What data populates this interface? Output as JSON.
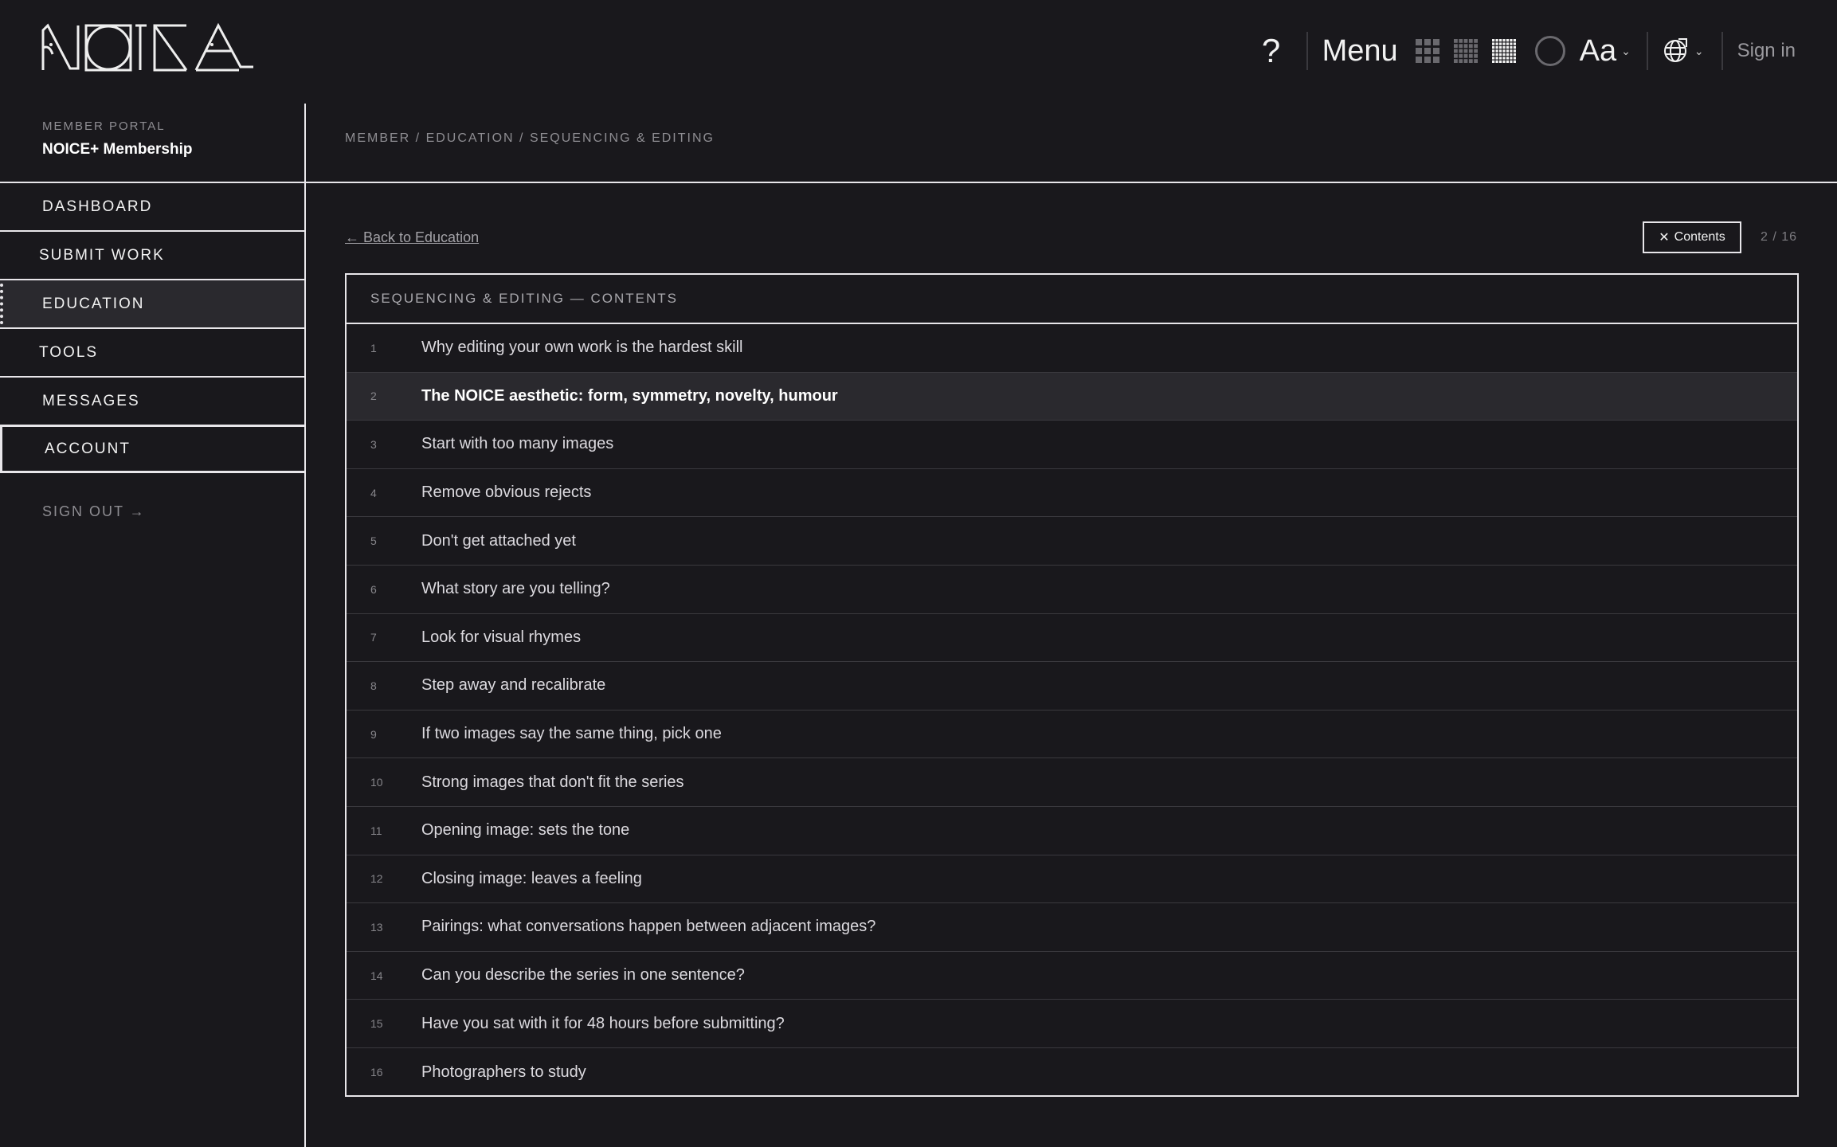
{
  "header": {
    "logo_text": "NOICE",
    "help_label": "?",
    "menu_label": "Menu",
    "view_icons": [
      "grid-small-icon",
      "grid-medium-icon",
      "grid-large-icon"
    ],
    "theme_icon": "theme-toggle-circle-icon",
    "font_label": "Aa",
    "language_icon": "globe-icon",
    "signin_label": "Sign in"
  },
  "sidebar": {
    "portal_label": "MEMBER PORTAL",
    "portal_name": "NOICE+ Membership",
    "items": [
      {
        "label": "DASHBOARD"
      },
      {
        "label": "SUBMIT WORK"
      },
      {
        "label": "EDUCATION"
      },
      {
        "label": "TOOLS"
      },
      {
        "label": "MESSAGES"
      },
      {
        "label": "ACCOUNT"
      }
    ],
    "signout_label": "SIGN OUT →"
  },
  "main": {
    "breadcrumb": "MEMBER / EDUCATION / SEQUENCING & EDITING",
    "back_link": "← Back to Education",
    "contents_button": "Contents",
    "pager": "2 / 16",
    "toc_heading": "SEQUENCING & EDITING — CONTENTS",
    "toc": [
      {
        "num": "1",
        "title": "Why editing your own work is the hardest skill"
      },
      {
        "num": "2",
        "title": "The NOICE aesthetic: form, symmetry, novelty, humour"
      },
      {
        "num": "3",
        "title": "Start with too many images"
      },
      {
        "num": "4",
        "title": "Remove obvious rejects"
      },
      {
        "num": "5",
        "title": "Don't get attached yet"
      },
      {
        "num": "6",
        "title": "What story are you telling?"
      },
      {
        "num": "7",
        "title": "Look for visual rhymes"
      },
      {
        "num": "8",
        "title": "Step away and recalibrate"
      },
      {
        "num": "9",
        "title": "If two images say the same thing, pick one"
      },
      {
        "num": "10",
        "title": "Strong images that don't fit the series"
      },
      {
        "num": "11",
        "title": "Opening image: sets the tone"
      },
      {
        "num": "12",
        "title": "Closing image: leaves a feeling"
      },
      {
        "num": "13",
        "title": "Pairings: what conversations happen between adjacent images?"
      },
      {
        "num": "14",
        "title": "Can you describe the series in one sentence?"
      },
      {
        "num": "15",
        "title": "Have you sat with it for 48 hours before submitting?"
      },
      {
        "num": "16",
        "title": "Photographers to study"
      }
    ]
  },
  "colors": {
    "background": "#19181c",
    "text": "#e8e6ea",
    "muted": "#8e8d92",
    "active_row": "#2a292e"
  }
}
